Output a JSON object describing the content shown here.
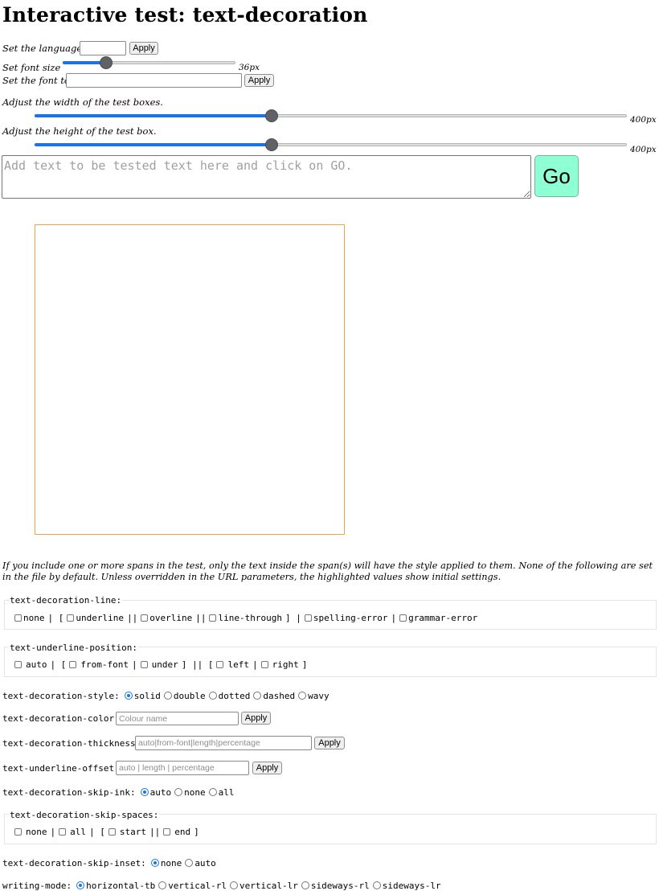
{
  "title": "Interactive test: text-decoration",
  "language": {
    "label": "Set the language",
    "value": "",
    "apply": "Apply"
  },
  "font_size": {
    "label": "Set font size",
    "value_text": "36px",
    "level_percent": 25
  },
  "font": {
    "label": "Set the font to",
    "value": "",
    "apply": "Apply"
  },
  "width": {
    "label": "Adjust the width of the test boxes.",
    "value_text": "400px",
    "level_percent": 40
  },
  "height": {
    "label": "Adjust the height of the test box.",
    "value_text": "400px",
    "level_percent": 40
  },
  "test_input": {
    "placeholder": "Add text to be tested text here and click on GO.",
    "go": "Go"
  },
  "note": "If you include one or more spans in the test, only the text inside the span(s) will have the style applied to them. None of the following are set in the file by default. Unless overridden in the URL parameters, the highlighted values show initial settings.",
  "tdl": {
    "legend": "text-decoration-line:",
    "none": "none",
    "underline": "underline",
    "overline": "overline",
    "line_through": "line-through",
    "spelling": "spelling-error",
    "grammar": "grammar-error",
    "s1": "| [",
    "s2": "||",
    "s3": "||",
    "s4": "] |",
    "s5": "|"
  },
  "tup": {
    "legend": "text-underline-position:",
    "auto": "auto",
    "from_font": "from-font",
    "under": "under",
    "left": "left",
    "right": "right",
    "s1": "| [",
    "s2": "|",
    "s3": "] || [",
    "s4": "|",
    "s5": "]"
  },
  "tds": {
    "label": "text-decoration-style:",
    "options": [
      "solid",
      "double",
      "dotted",
      "dashed",
      "wavy"
    ],
    "selected": "solid"
  },
  "tdc": {
    "label": "text-decoration-color:",
    "placeholder": "Colour name",
    "apply": "Apply"
  },
  "tdt": {
    "label": "text-decoration-thickness:",
    "placeholder": "auto|from-font|length|percentage",
    "apply": "Apply"
  },
  "tuo": {
    "label": "text-underline-offset:",
    "placeholder": "auto | length | percentage",
    "apply": "Apply"
  },
  "tdsi": {
    "label": "text-decoration-skip-ink:",
    "options": [
      "auto",
      "none",
      "all"
    ],
    "selected": "auto"
  },
  "tdss": {
    "legend": "text-decoration-skip-spaces:",
    "none": "none",
    "all": "all",
    "start": "start",
    "end": "end",
    "s1": "|",
    "s2": "| [",
    "s3": "||",
    "s4": "]"
  },
  "tdsin": {
    "label": "text-decoration-skip-inset:",
    "options": [
      "none",
      "auto"
    ],
    "selected": "none"
  },
  "wm": {
    "label": "writing-mode:",
    "options": [
      "horizontal-tb",
      "vertical-rl",
      "vertical-lr",
      "sideways-rl",
      "sideways-lr"
    ],
    "selected": "horizontal-tb"
  },
  "colors": {
    "go_bg": "#8fffd4",
    "box_border": "#e8a540",
    "accent": "#1a73e8"
  }
}
